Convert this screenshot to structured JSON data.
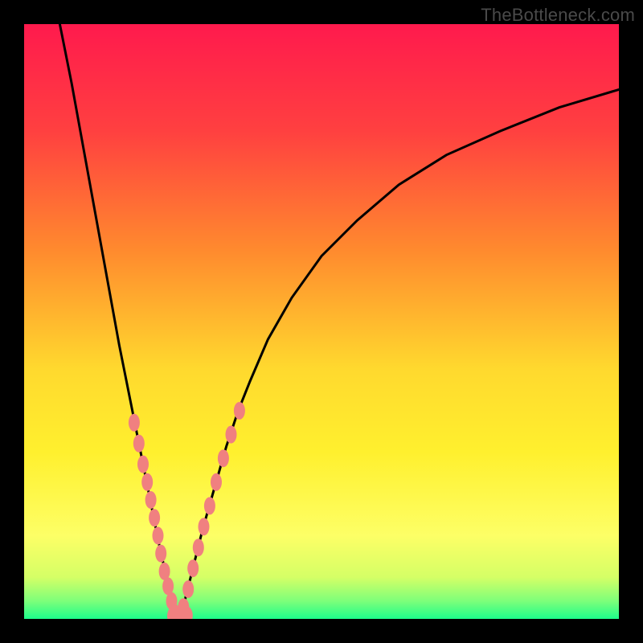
{
  "watermark": {
    "text": "TheBottleneck.com"
  },
  "chart_data": {
    "type": "line",
    "title": "",
    "xlabel": "",
    "ylabel": "",
    "xlim": [
      0,
      100
    ],
    "ylim": [
      0,
      100
    ],
    "gradient_stops": [
      {
        "pct": 0,
        "color": "#ff1a4d"
      },
      {
        "pct": 18,
        "color": "#ff4040"
      },
      {
        "pct": 38,
        "color": "#ff8a2e"
      },
      {
        "pct": 58,
        "color": "#ffd92e"
      },
      {
        "pct": 72,
        "color": "#fff02e"
      },
      {
        "pct": 86,
        "color": "#fdff66"
      },
      {
        "pct": 93,
        "color": "#d5ff66"
      },
      {
        "pct": 97,
        "color": "#7dff7a"
      },
      {
        "pct": 100,
        "color": "#1dfd8b"
      }
    ],
    "series": [
      {
        "name": "left-branch",
        "style": "line",
        "x": [
          6,
          8,
          10,
          12,
          14,
          16,
          18,
          19,
          20,
          21,
          22,
          23,
          24,
          25,
          26
        ],
        "y": [
          100,
          90,
          79,
          68,
          57,
          46,
          36,
          31,
          26,
          21,
          16,
          11,
          7,
          3,
          0
        ]
      },
      {
        "name": "right-branch",
        "style": "line",
        "x": [
          26,
          27,
          28,
          29,
          30,
          32,
          34,
          36,
          38,
          41,
          45,
          50,
          56,
          63,
          71,
          80,
          90,
          100
        ],
        "y": [
          0,
          3,
          7,
          11,
          15,
          22,
          29,
          35,
          40,
          47,
          54,
          61,
          67,
          73,
          78,
          82,
          86,
          89
        ]
      },
      {
        "name": "left-markers",
        "style": "markers",
        "x": [
          18.5,
          19.3,
          20.0,
          20.7,
          21.3,
          21.9,
          22.5,
          23.0,
          23.6,
          24.2,
          24.8,
          25.3
        ],
        "y": [
          33,
          29.5,
          26,
          23,
          20,
          17,
          14,
          11,
          8,
          5.5,
          3,
          1
        ]
      },
      {
        "name": "right-markers",
        "style": "markers",
        "x": [
          26.8,
          27.6,
          28.4,
          29.3,
          30.2,
          31.2,
          32.3,
          33.5,
          34.8,
          36.2
        ],
        "y": [
          2,
          5,
          8.5,
          12,
          15.5,
          19,
          23,
          27,
          31,
          35
        ]
      },
      {
        "name": "bottom-markers",
        "style": "markers",
        "x": [
          25.0,
          25.6,
          26.2,
          26.8,
          27.4
        ],
        "y": [
          0.5,
          0.3,
          0.3,
          0.4,
          0.6
        ]
      }
    ],
    "marker_style": {
      "fill": "#f08080",
      "rx": 7,
      "ry": 11
    },
    "line_style": {
      "stroke": "#000000",
      "width": 3
    }
  }
}
